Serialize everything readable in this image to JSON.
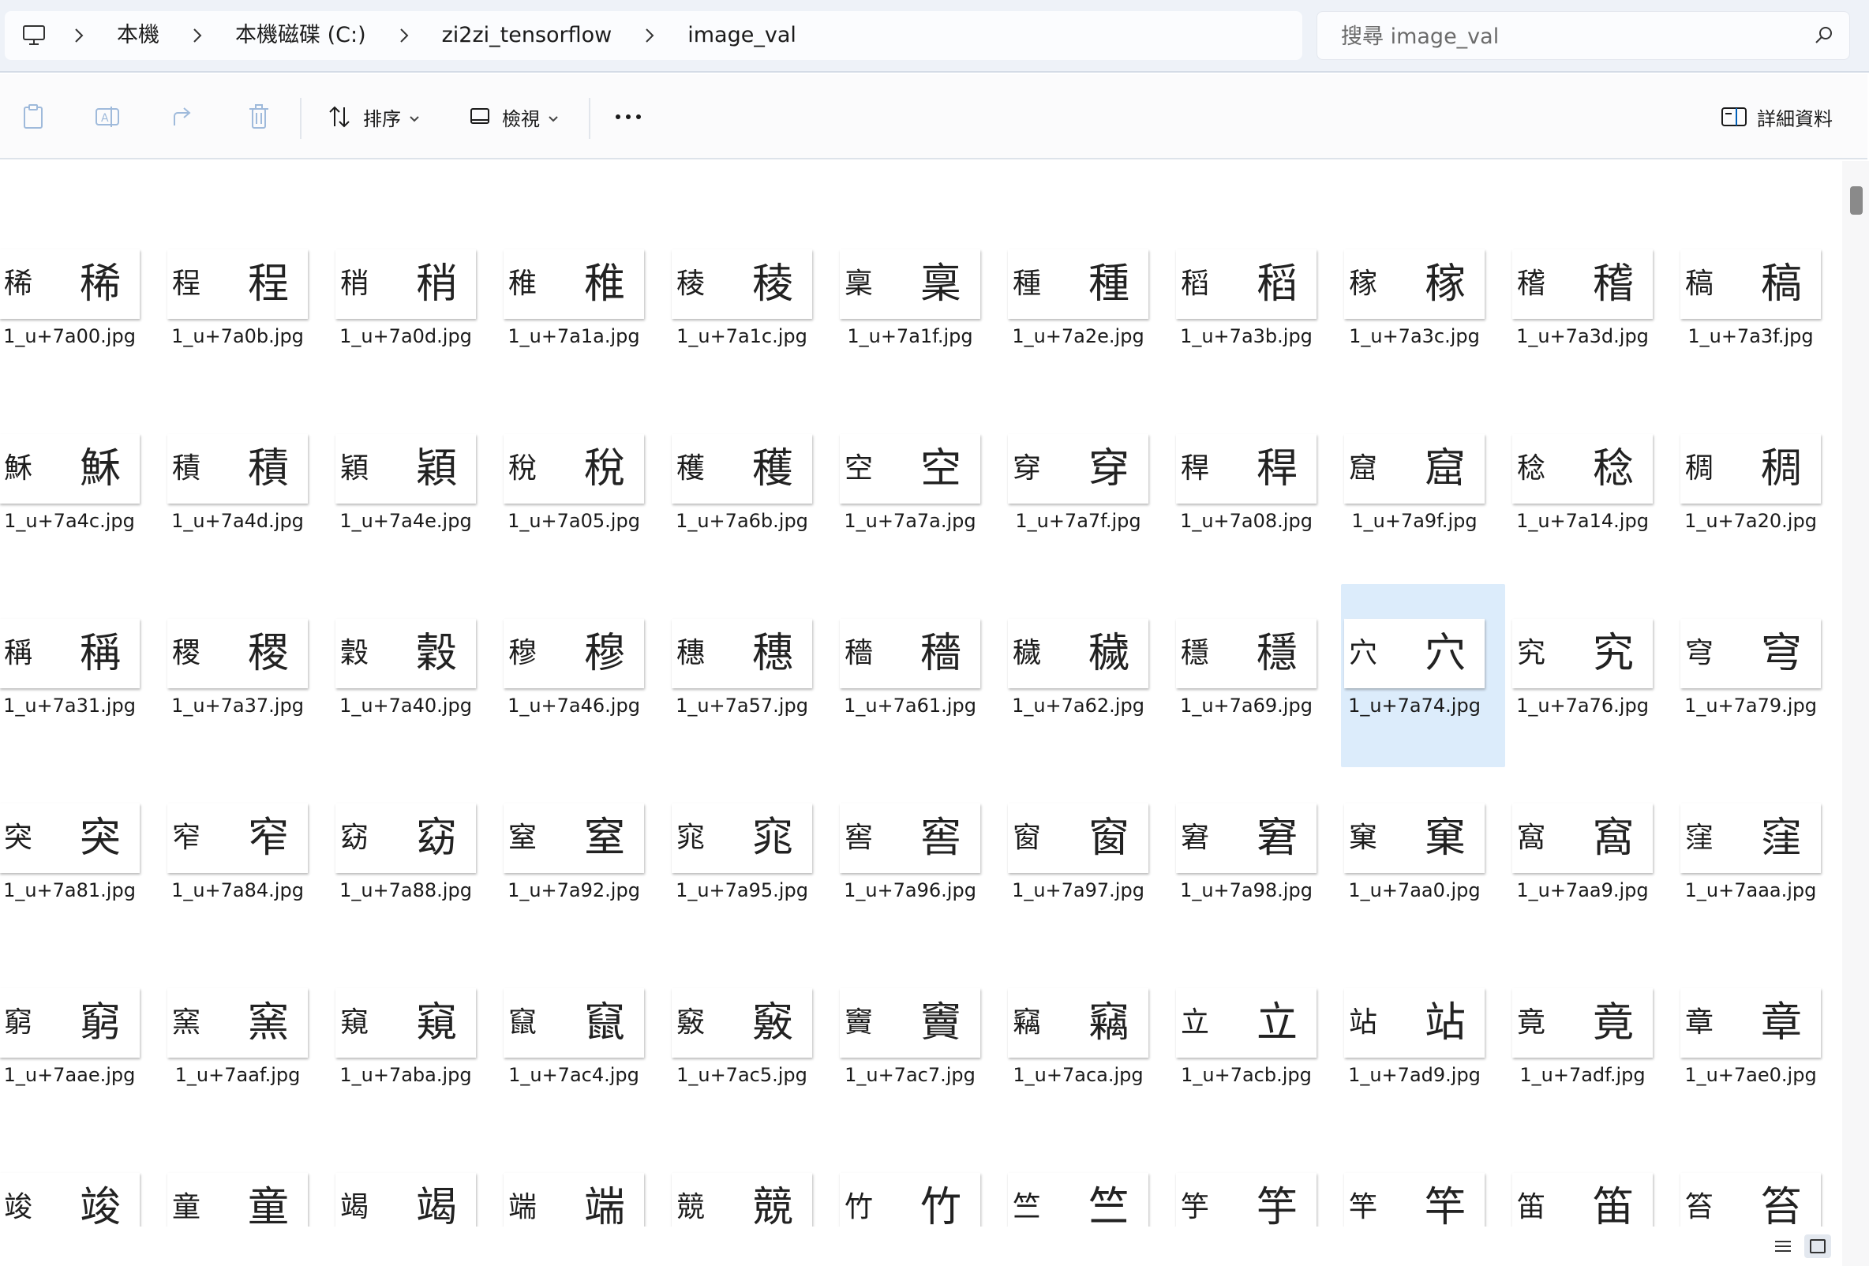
{
  "breadcrumb": {
    "items": [
      "本機",
      "本機磁碟 (C:)",
      "zi2zi_tensorflow",
      "image_val"
    ]
  },
  "search": {
    "placeholder": "搜尋 image_val"
  },
  "toolbar": {
    "sort_label": "排序",
    "view_label": "檢視",
    "more_label": "…",
    "details_label": "詳細資料"
  },
  "files": [
    {
      "name": "1_u+7a00.jpg",
      "glyph": "稀"
    },
    {
      "name": "1_u+7a0b.jpg",
      "glyph": "程"
    },
    {
      "name": "1_u+7a0d.jpg",
      "glyph": "稍"
    },
    {
      "name": "1_u+7a1a.jpg",
      "glyph": "稚"
    },
    {
      "name": "1_u+7a1c.jpg",
      "glyph": "稜"
    },
    {
      "name": "1_u+7a1f.jpg",
      "glyph": "稟"
    },
    {
      "name": "1_u+7a2e.jpg",
      "glyph": "種"
    },
    {
      "name": "1_u+7a3b.jpg",
      "glyph": "稻"
    },
    {
      "name": "1_u+7a3c.jpg",
      "glyph": "稼"
    },
    {
      "name": "1_u+7a3d.jpg",
      "glyph": "稽"
    },
    {
      "name": "1_u+7a3f.jpg",
      "glyph": "稿"
    },
    {
      "name": "1_u+7a4c.jpg",
      "glyph": "穌"
    },
    {
      "name": "1_u+7a4d.jpg",
      "glyph": "積"
    },
    {
      "name": "1_u+7a4e.jpg",
      "glyph": "穎"
    },
    {
      "name": "1_u+7a05.jpg",
      "glyph": "稅"
    },
    {
      "name": "1_u+7a6b.jpg",
      "glyph": "穫"
    },
    {
      "name": "1_u+7a7a.jpg",
      "glyph": "空"
    },
    {
      "name": "1_u+7a7f.jpg",
      "glyph": "穿"
    },
    {
      "name": "1_u+7a08.jpg",
      "glyph": "稈"
    },
    {
      "name": "1_u+7a9f.jpg",
      "glyph": "窟"
    },
    {
      "name": "1_u+7a14.jpg",
      "glyph": "稔"
    },
    {
      "name": "1_u+7a20.jpg",
      "glyph": "稠"
    },
    {
      "name": "1_u+7a31.jpg",
      "glyph": "稱"
    },
    {
      "name": "1_u+7a37.jpg",
      "glyph": "稷"
    },
    {
      "name": "1_u+7a40.jpg",
      "glyph": "穀"
    },
    {
      "name": "1_u+7a46.jpg",
      "glyph": "穆"
    },
    {
      "name": "1_u+7a57.jpg",
      "glyph": "穗"
    },
    {
      "name": "1_u+7a61.jpg",
      "glyph": "穡"
    },
    {
      "name": "1_u+7a62.jpg",
      "glyph": "穢"
    },
    {
      "name": "1_u+7a69.jpg",
      "glyph": "穩"
    },
    {
      "name": "1_u+7a74.jpg",
      "glyph": "穴",
      "selected": true
    },
    {
      "name": "1_u+7a76.jpg",
      "glyph": "究"
    },
    {
      "name": "1_u+7a79.jpg",
      "glyph": "穹"
    },
    {
      "name": "1_u+7a81.jpg",
      "glyph": "突"
    },
    {
      "name": "1_u+7a84.jpg",
      "glyph": "窄"
    },
    {
      "name": "1_u+7a88.jpg",
      "glyph": "窈"
    },
    {
      "name": "1_u+7a92.jpg",
      "glyph": "窒"
    },
    {
      "name": "1_u+7a95.jpg",
      "glyph": "窕"
    },
    {
      "name": "1_u+7a96.jpg",
      "glyph": "窖"
    },
    {
      "name": "1_u+7a97.jpg",
      "glyph": "窗"
    },
    {
      "name": "1_u+7a98.jpg",
      "glyph": "窘"
    },
    {
      "name": "1_u+7aa0.jpg",
      "glyph": "窠"
    },
    {
      "name": "1_u+7aa9.jpg",
      "glyph": "窩"
    },
    {
      "name": "1_u+7aaa.jpg",
      "glyph": "窪"
    },
    {
      "name": "1_u+7aae.jpg",
      "glyph": "窮"
    },
    {
      "name": "1_u+7aaf.jpg",
      "glyph": "窯"
    },
    {
      "name": "1_u+7aba.jpg",
      "glyph": "窺"
    },
    {
      "name": "1_u+7ac4.jpg",
      "glyph": "竄"
    },
    {
      "name": "1_u+7ac5.jpg",
      "glyph": "竅"
    },
    {
      "name": "1_u+7ac7.jpg",
      "glyph": "竇"
    },
    {
      "name": "1_u+7aca.jpg",
      "glyph": "竊"
    },
    {
      "name": "1_u+7acb.jpg",
      "glyph": "立"
    },
    {
      "name": "1_u+7ad9.jpg",
      "glyph": "站"
    },
    {
      "name": "1_u+7adf.jpg",
      "glyph": "竟"
    },
    {
      "name": "1_u+7ae0.jpg",
      "glyph": "章"
    },
    {
      "name": "",
      "glyph": "竣"
    },
    {
      "name": "",
      "glyph": "童"
    },
    {
      "name": "",
      "glyph": "竭"
    },
    {
      "name": "",
      "glyph": "端"
    },
    {
      "name": "",
      "glyph": "競"
    },
    {
      "name": "",
      "glyph": "竹"
    },
    {
      "name": "",
      "glyph": "竺"
    },
    {
      "name": "",
      "glyph": "竽"
    },
    {
      "name": "",
      "glyph": "竿"
    },
    {
      "name": "",
      "glyph": "笛"
    },
    {
      "name": "",
      "glyph": "笞"
    }
  ],
  "colors": {
    "selection": "#dcecfb",
    "accent": "#005fb8"
  }
}
